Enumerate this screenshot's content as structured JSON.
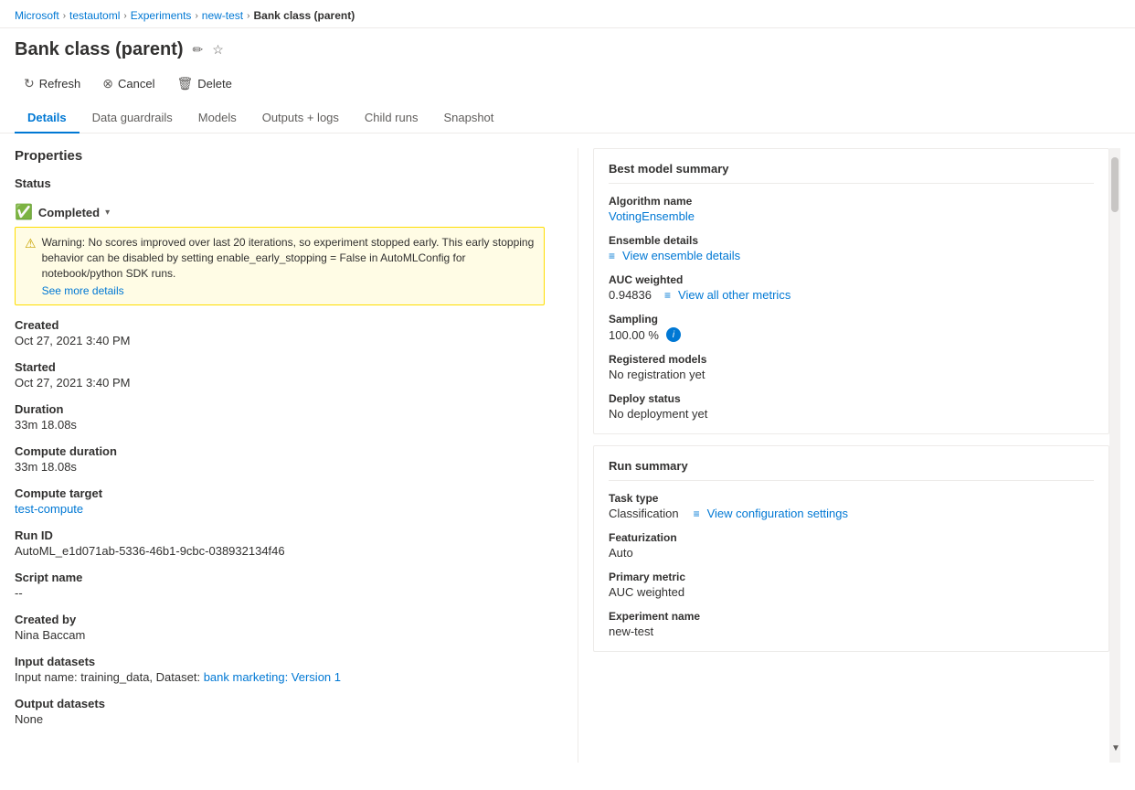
{
  "breadcrumb": {
    "items": [
      {
        "label": "Microsoft",
        "href": "#"
      },
      {
        "label": "testautoml",
        "href": "#"
      },
      {
        "label": "Experiments",
        "href": "#"
      },
      {
        "label": "new-test",
        "href": "#"
      },
      {
        "label": "Bank class (parent)",
        "current": true
      }
    ]
  },
  "page": {
    "title": "Bank class (parent)",
    "edit_icon": "✏",
    "star_icon": "☆"
  },
  "toolbar": {
    "refresh_label": "Refresh",
    "cancel_label": "Cancel",
    "delete_label": "Delete"
  },
  "tabs": {
    "items": [
      {
        "label": "Details",
        "active": true
      },
      {
        "label": "Data guardrails"
      },
      {
        "label": "Models"
      },
      {
        "label": "Outputs + logs"
      },
      {
        "label": "Child runs"
      },
      {
        "label": "Snapshot"
      }
    ]
  },
  "properties": {
    "title": "Properties",
    "status_label": "Status",
    "status_value": "Completed",
    "warning_text": "Warning: No scores improved over last 20 iterations, so experiment stopped early. This early stopping behavior can be disabled by setting enable_early_stopping = False in AutoMLConfig for notebook/python SDK runs.",
    "see_more_label": "See more details",
    "created_label": "Created",
    "created_value": "Oct 27, 2021 3:40 PM",
    "started_label": "Started",
    "started_value": "Oct 27, 2021 3:40 PM",
    "duration_label": "Duration",
    "duration_value": "33m 18.08s",
    "compute_duration_label": "Compute duration",
    "compute_duration_value": "33m 18.08s",
    "compute_target_label": "Compute target",
    "compute_target_value": "test-compute",
    "run_id_label": "Run ID",
    "run_id_value": "AutoML_e1d071ab-5336-46b1-9cbc-038932134f46",
    "script_name_label": "Script name",
    "script_name_value": "--",
    "created_by_label": "Created by",
    "created_by_value": "Nina Baccam",
    "input_datasets_label": "Input datasets",
    "input_datasets_prefix": "Input name: training_data, Dataset: ",
    "input_datasets_link_text": "bank marketing: Version 1",
    "output_datasets_label": "Output datasets",
    "output_datasets_value": "None"
  },
  "best_model": {
    "title": "Best model summary",
    "algorithm_label": "Algorithm name",
    "algorithm_value": "VotingEnsemble",
    "ensemble_label": "Ensemble details",
    "ensemble_link": "View ensemble details",
    "auc_label": "AUC weighted",
    "auc_value": "0.94836",
    "view_metrics_link": "View all other metrics",
    "sampling_label": "Sampling",
    "sampling_value": "100.00 %",
    "registered_label": "Registered models",
    "registered_value": "No registration yet",
    "deploy_label": "Deploy status",
    "deploy_value": "No deployment yet"
  },
  "run_summary": {
    "title": "Run summary",
    "task_type_label": "Task type",
    "task_type_value": "Classification",
    "view_config_link": "View configuration settings",
    "featurization_label": "Featurization",
    "featurization_value": "Auto",
    "primary_metric_label": "Primary metric",
    "primary_metric_value": "AUC weighted",
    "experiment_name_label": "Experiment name",
    "experiment_name_value": "new-test"
  }
}
